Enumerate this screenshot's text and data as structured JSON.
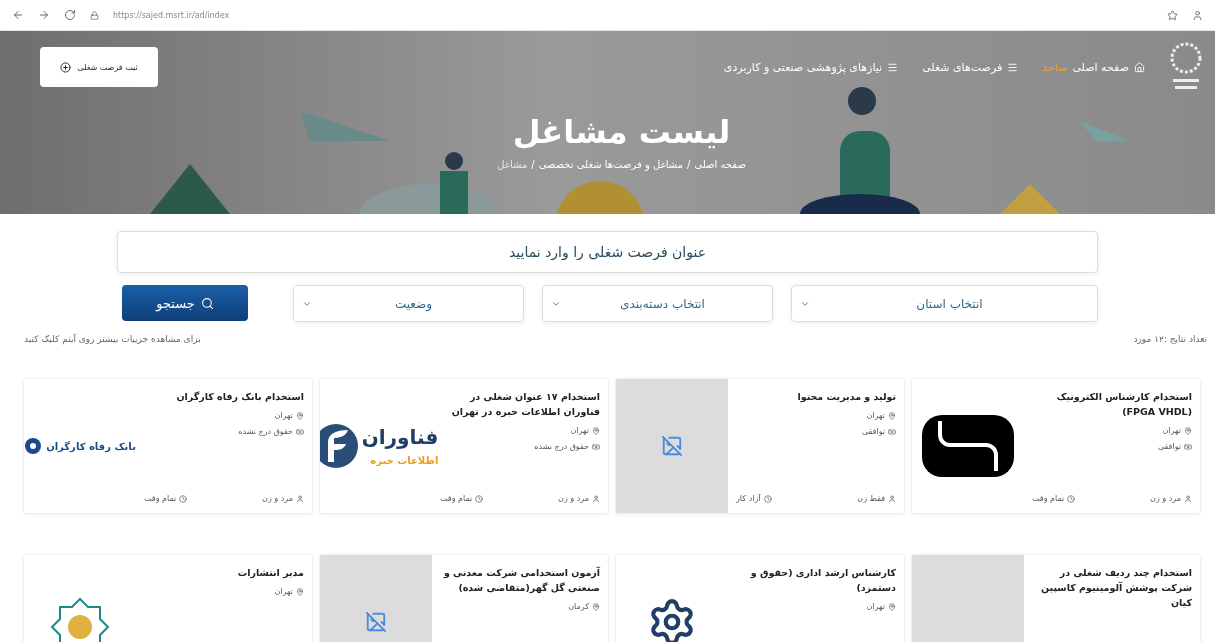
{
  "browser": {
    "url": "https://sajed.msrt.ir/ad/index"
  },
  "nav": {
    "items": [
      {
        "label": "صفحه اصلی",
        "highlight": "ساجد",
        "kind": "home"
      },
      {
        "label": "فرصت‌های شغلی",
        "kind": "list"
      },
      {
        "label": "نیازهای پژوهشی صنعتی و کاربردی",
        "kind": "list"
      }
    ],
    "post_button": "ثبت فرصت شغلی"
  },
  "hero": {
    "title": "لیست مشاغل",
    "breadcrumb": [
      "صفحه اصلی",
      "مشاغل و فرصت‌ها شغلی تخصصی",
      "مشاغل"
    ],
    "separator": "/"
  },
  "search": {
    "placeholder": "عنوان فرصت شغلی را وارد نمایید",
    "filters": [
      "انتخاب استان",
      "انتخاب دسته‌بندی",
      "وضعیت"
    ],
    "button": "جستجو"
  },
  "results": {
    "count": "تعداد نتایج :۱۲ مورد",
    "hint": "برای مشاهده جزییات بیشتر روی آیتم کلیک کنید"
  },
  "cards": [
    {
      "title": "استخدام کارشناس الکترونیک (FPGA VHDL)",
      "city": "تهران",
      "salary": "توافقی",
      "gender": "مرد و زن",
      "type": "تمام وقت",
      "logo": {
        "kind": "mark"
      }
    },
    {
      "title": "تولید و مدیریت محتوا",
      "city": "تهران",
      "salary": "توافقی",
      "gender": "فقط زن",
      "type": "آزاد کار",
      "logo": {
        "kind": "placeholder"
      }
    },
    {
      "title": "استخدام ۱۷ عنوان شغلی در فناوران اطلاعات خبره در تهران",
      "city": "تهران",
      "salary": "حقوق درج نشده",
      "gender": "مرد و زن",
      "type": "تمام وقت",
      "logo": {
        "kind": "brand",
        "text": "فناوران",
        "subtext": "اطلاعات خبره"
      }
    },
    {
      "title": "استخدام بانک رفاه کارگران",
      "city": "تهران",
      "salary": "حقوق درج نشده",
      "gender": "مرد و زن",
      "type": "تمام وقت",
      "logo": {
        "kind": "bank",
        "text": "بانک رفاه کارگران"
      }
    },
    {
      "title": "استخدام چند ردیف شغلی در شرکت پوشش آلومینیوم کاسپین کیان",
      "logo": {
        "kind": "blank"
      }
    },
    {
      "title": "کارشناس ارشد اداری (حقوق و دستمزد)",
      "city": "تهران",
      "logo": {
        "kind": "gear"
      }
    },
    {
      "title": "آزمون استخدامی شرکت معدنی و صنعتی گل گهر(متقاضی شده)",
      "city": "کرمان",
      "logo": {
        "kind": "placeholder"
      }
    },
    {
      "title": "مدیر انتشارات",
      "city": "تهران",
      "logo": {
        "kind": "ornament"
      }
    }
  ]
}
